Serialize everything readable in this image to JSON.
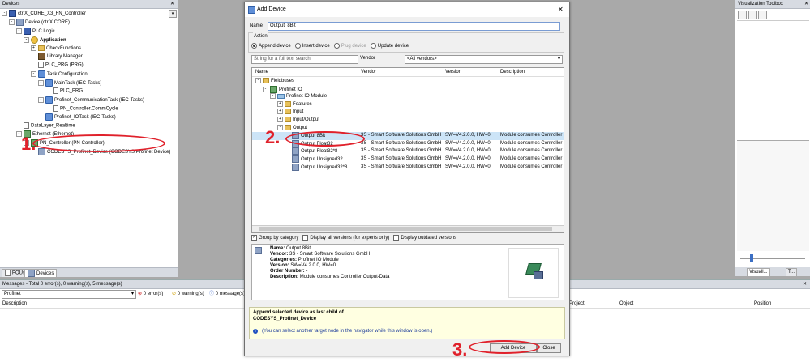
{
  "devices_panel": {
    "title": "Devices",
    "tree": [
      {
        "label": "ctrlX_CORE_X3_FN_Controller",
        "level": 0,
        "icon": "project",
        "expander": "-"
      },
      {
        "label": "Device (ctrlX CORE)",
        "level": 1,
        "icon": "dev",
        "expander": "-"
      },
      {
        "label": "PLC Logic",
        "level": 2,
        "icon": "plc",
        "expander": "-"
      },
      {
        "label": "Application",
        "level": 3,
        "icon": "gear",
        "expander": "-",
        "bold": true
      },
      {
        "label": "CheckFunctions",
        "level": 4,
        "icon": "folder",
        "expander": "+"
      },
      {
        "label": "Library Manager",
        "level": 4,
        "icon": "book",
        "expander": ""
      },
      {
        "label": "PLC_PRG (PRG)",
        "level": 4,
        "icon": "page",
        "expander": ""
      },
      {
        "label": "Task Configuration",
        "level": 4,
        "icon": "task",
        "expander": "-"
      },
      {
        "label": "MainTask (IEC-Tasks)",
        "level": 5,
        "icon": "task",
        "expander": "-"
      },
      {
        "label": "PLC_PRG",
        "level": 6,
        "icon": "page",
        "expander": ""
      },
      {
        "label": "Profinet_CommunicationTask (IEC-Tasks)",
        "level": 5,
        "icon": "task",
        "expander": "-"
      },
      {
        "label": "PN_Controller.CommCycle",
        "level": 6,
        "icon": "page",
        "expander": ""
      },
      {
        "label": "Profinet_IOTask (IEC-Tasks)",
        "level": 5,
        "icon": "task",
        "expander": ""
      },
      {
        "label": "DataLayer_Realtime",
        "level": 2,
        "icon": "page",
        "expander": ""
      },
      {
        "label": "Ethernet (Ethernet)",
        "level": 2,
        "icon": "eth",
        "expander": "-"
      },
      {
        "label": "PN_Controller (PN-Controller)",
        "level": 3,
        "icon": "eth",
        "expander": "-"
      },
      {
        "label": "CODESYS_Profinet_Device (CODESYS Profinet Device)",
        "level": 4,
        "icon": "dev",
        "expander": ""
      }
    ],
    "tabs": [
      "POUs",
      "Devices"
    ]
  },
  "messages_panel": {
    "title": "Messages - Total 0 error(s), 0 warning(s), 5 message(s)",
    "filter_value": "Profinet",
    "errors": "0 error(s)",
    "warnings": "0 warning(s)",
    "messages": "0 message(s)",
    "columns": {
      "description": "Description",
      "project": "Project",
      "object": "Object",
      "position": "Position"
    }
  },
  "toolbox_panel": {
    "title": "Visualization Toolbox",
    "tabs": [
      "Visuali...",
      "T..."
    ]
  },
  "dialog": {
    "title": "Add Device",
    "close_glyph": "✕",
    "name_label": "Name",
    "name_value": "Output_8Bit",
    "action_label": "Action",
    "actions": [
      {
        "label": "Append device",
        "selected": true,
        "enabled": true
      },
      {
        "label": "Insert device",
        "selected": false,
        "enabled": true
      },
      {
        "label": "Plug device",
        "selected": false,
        "enabled": false
      },
      {
        "label": "Update device",
        "selected": false,
        "enabled": true
      }
    ],
    "search_placeholder": "String for a full text search",
    "vendor_label": "Vendor",
    "vendor_value": "<All vendors>",
    "columns": {
      "name": "Name",
      "vendor": "Vendor",
      "version": "Version",
      "description": "Description"
    },
    "tree": [
      {
        "name": "Fieldbuses",
        "level": 0,
        "icon": "folder",
        "expander": "-",
        "vendor": "",
        "version": "",
        "description": ""
      },
      {
        "name": "Profinet IO",
        "level": 1,
        "icon": "eth",
        "expander": "-",
        "vendor": "",
        "version": "",
        "description": ""
      },
      {
        "name": "Profinet IO Module",
        "level": 2,
        "icon": "mod",
        "expander": "-",
        "vendor": "",
        "version": "",
        "description": ""
      },
      {
        "name": "Features",
        "level": 3,
        "icon": "folder",
        "expander": "+",
        "vendor": "",
        "version": "",
        "description": ""
      },
      {
        "name": "Input",
        "level": 3,
        "icon": "folder",
        "expander": "+",
        "vendor": "",
        "version": "",
        "description": ""
      },
      {
        "name": "Input/Output",
        "level": 3,
        "icon": "folder",
        "expander": "+",
        "vendor": "",
        "version": "",
        "description": ""
      },
      {
        "name": "Output",
        "level": 3,
        "icon": "folder",
        "expander": "-",
        "vendor": "",
        "version": "",
        "description": ""
      },
      {
        "name": "Output 8Bit",
        "level": 4,
        "icon": "dev",
        "expander": "",
        "vendor": "3S - Smart Software Solutions GmbH",
        "version": "SW=V4.2.0.0, HW=0",
        "description": "Module consumes Controller Ou",
        "selected": true
      },
      {
        "name": "Output Float32",
        "level": 4,
        "icon": "dev",
        "expander": "",
        "vendor": "3S - Smart Software Solutions GmbH",
        "version": "SW=V4.2.0.0, HW=0",
        "description": "Module consumes Controller Ou"
      },
      {
        "name": "Output Float32*8",
        "level": 4,
        "icon": "dev",
        "expander": "",
        "vendor": "3S - Smart Software Solutions GmbH",
        "version": "SW=V4.2.0.0, HW=0",
        "description": "Module consumes Controller Ou"
      },
      {
        "name": "Output Unsigned32",
        "level": 4,
        "icon": "dev",
        "expander": "",
        "vendor": "3S - Smart Software Solutions GmbH",
        "version": "SW=V4.2.0.0, HW=0",
        "description": "Module consumes Controller Ou"
      },
      {
        "name": "Output Unsigned32*8",
        "level": 4,
        "icon": "dev",
        "expander": "",
        "vendor": "3S - Smart Software Solutions GmbH",
        "version": "SW=V4.2.0.0, HW=0",
        "description": "Module consumes Controller Ou"
      }
    ],
    "options": [
      {
        "label": "Group by category",
        "checked": true
      },
      {
        "label": "Display all versions (for experts only)",
        "checked": false
      },
      {
        "label": "Display outdated versions",
        "checked": false
      }
    ],
    "info": {
      "name_k": "Name:",
      "name_v": "Output 8Bit",
      "vendor_k": "Vendor:",
      "vendor_v": "3S - Smart Software Solutions GmbH",
      "categories_k": "Categories:",
      "categories_v": "Profinet IO Module",
      "version_k": "Version:",
      "version_v": "SW=V4.2.0.0, HW=0",
      "order_k": "Order Number:",
      "order_v": "-",
      "desc_k": "Description:",
      "desc_v": "Module consumes Controller Output-Data"
    },
    "hint_line1": "Append selected device as last child of",
    "hint_line2": "CODESYS_Profinet_Device",
    "hint_note": "(You can select another target node in the navigator while this window is open.)",
    "add_button": "Add Device",
    "close_button": "Close"
  },
  "annotations": {
    "step1": "1.",
    "step2": "2.",
    "step3": "3.",
    "color": "#e0212b"
  }
}
